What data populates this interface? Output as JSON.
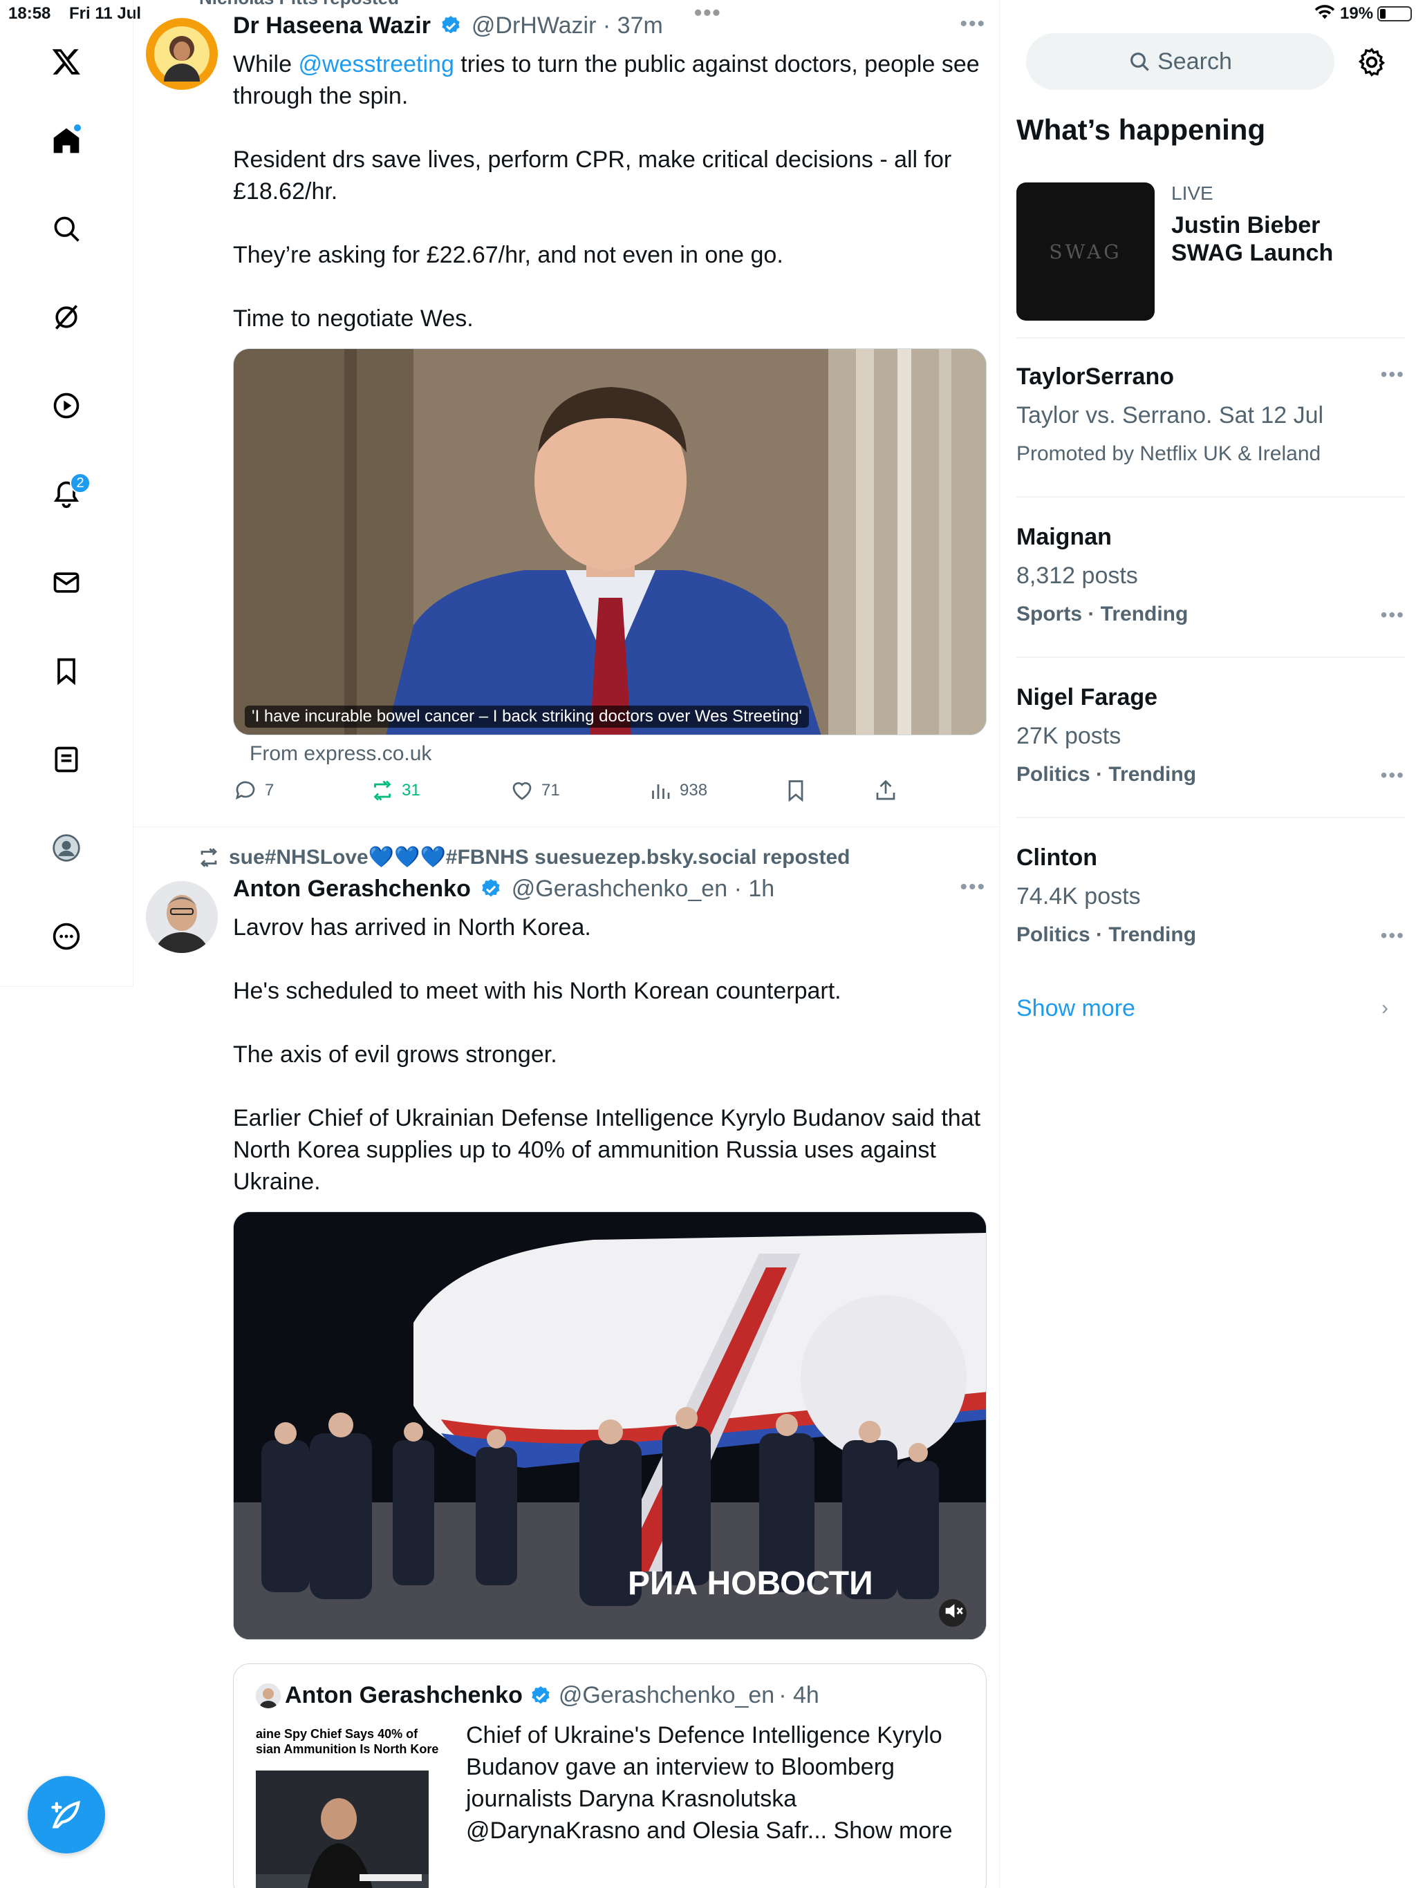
{
  "status_bar": {
    "time": "18:58",
    "date": "Fri 11 Jul",
    "battery": "19%"
  },
  "nav": {
    "notifications_count": "2"
  },
  "tweets": [
    {
      "repost_by": "Nicholas Pitts reposted",
      "name": "Dr Haseena Wazir",
      "handle": "@DrHWazir",
      "time": "· 37m",
      "text_mention": "@wesstreeting",
      "text_pre": "While ",
      "text_post": " tries to turn the public against doctors, people see through the spin.",
      "paragraphs": [
        "Resident drs save lives, perform CPR, make critical decisions - all for £18.62/hr.",
        "They’re asking for £22.67/hr, and not even in one go.",
        "Time to negotiate Wes."
      ],
      "media_caption": "'I have incurable bowel cancer – I back striking doctors over Wes Streeting'",
      "from": "From express.co.uk",
      "replies": "7",
      "reposts": "31",
      "likes": "71",
      "views": "938"
    },
    {
      "repost_by": "sue#NHSLove💙💙💙#FBNHS suesuezep.bsky.social reposted",
      "name": "Anton Gerashchenko",
      "handle": "@Gerashchenko_en",
      "time": "· 1h",
      "paragraphs": [
        "Lavrov has arrived in North Korea.",
        "He's scheduled to meet with his North Korean counterpart.",
        "The axis of evil grows stronger.",
        "Earlier Chief of Ukrainian Defense Intelligence Kyrylo Budanov said that North Korea supplies up to 40% of ammunition Russia uses against Ukraine."
      ],
      "media_watermark": "РИА НОВОСТИ",
      "quote": {
        "name": "Anton Gerashchenko",
        "handle": "@Gerashchenko_en",
        "time": "· 4h",
        "thumb_line1": "aine Spy Chief Says 40% of",
        "thumb_line2": "sian Ammunition Is North Kore",
        "text": "Chief of Ukraine's Defence Intelligence Kyrylo Budanov gave an interview to Bloomberg journalists Daryna Krasnolutska @DarynaKrasno and Olesia Safr... Show more"
      }
    }
  ],
  "sidebar": {
    "search_placeholder": "Search",
    "heading": "What’s happening",
    "live": {
      "label": "LIVE",
      "title": "Justin Bieber SWAG Launch",
      "image_text": "SWAG"
    },
    "trends": [
      {
        "name": "TaylorSerrano",
        "sub": "Taylor vs. Serrano. Sat 12 Jul",
        "meta_plain": "Promoted by Netflix UK & Ireland",
        "meta_bold": ""
      },
      {
        "name": "Maignan",
        "sub": "8,312 posts",
        "meta_plain": "",
        "meta_bold": "Sports · Trending"
      },
      {
        "name": "Nigel Farage",
        "sub": "27K posts",
        "meta_plain": "",
        "meta_bold": "Politics · Trending"
      },
      {
        "name": "Clinton",
        "sub": "74.4K posts",
        "meta_plain": "",
        "meta_bold": "Politics · Trending"
      }
    ],
    "show_more": "Show more"
  },
  "colors": {
    "accent": "#1d9bf0",
    "repost_green": "#00ba7c",
    "muted": "#536471"
  }
}
